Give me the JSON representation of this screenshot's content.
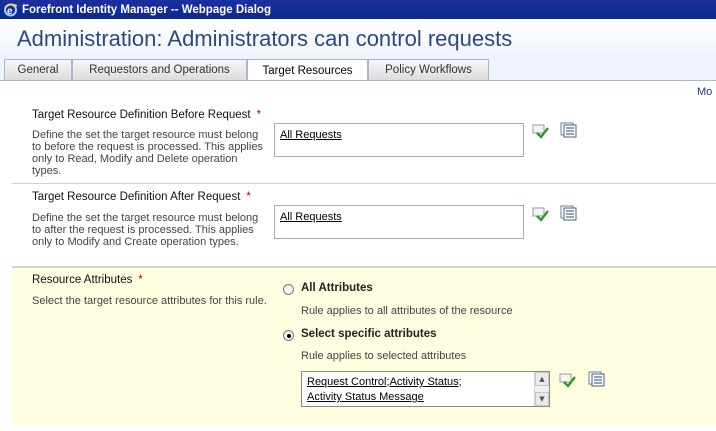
{
  "window": {
    "title": "Forefront Identity Manager -- Webpage Dialog"
  },
  "header": {
    "title": "Administration: Administrators can control requests"
  },
  "tabs": [
    {
      "label": "General"
    },
    {
      "label": "Requestors and Operations"
    },
    {
      "label": "Target Resources"
    },
    {
      "label": "Policy Workflows"
    }
  ],
  "active_tab": "Target Resources",
  "more_link": "Mo",
  "sections": [
    {
      "label": "Target Resource Definition Before Request",
      "required": "*",
      "description": "Define the set the target resource must belong to before the request is processed. This applies only to Read, Modify and Delete operation types.",
      "value": "All Requests"
    },
    {
      "label": "Target Resource Definition After Request",
      "required": "*",
      "description": "Define the set the target resource must belong to after the request is processed. This applies only to Modify and Create operation types.",
      "value": "All Requests"
    }
  ],
  "resource_attributes": {
    "label": "Resource Attributes",
    "required": "*",
    "description": "Select the target resource attributes for this rule.",
    "options": [
      {
        "label": "All Attributes",
        "description": "Rule applies to all attributes of the resource",
        "checked": false
      },
      {
        "label": "Select specific attributes",
        "description": "Rule applies to selected attributes",
        "checked": true
      }
    ],
    "selected_attributes": [
      "Request Control",
      "Activity Status",
      "Activity Status Message"
    ],
    "separator": ";"
  },
  "icons": {
    "validate": "validate-check-icon",
    "browse": "browse-list-icon",
    "app": "ie-icon"
  },
  "colors": {
    "titlebar": "#0a2a8c",
    "page_title": "#2b4a7c",
    "highlight_bg": "#fffde0",
    "required": "#c00000"
  }
}
